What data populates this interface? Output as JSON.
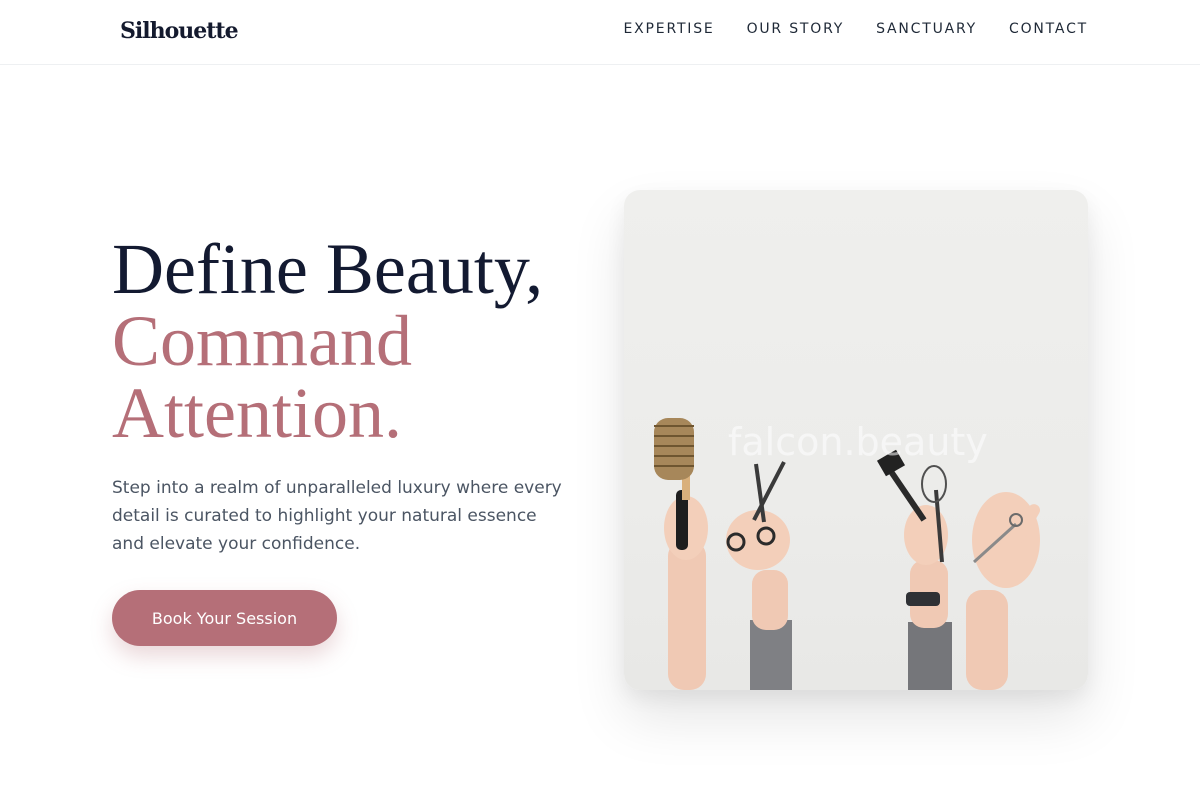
{
  "brand": {
    "logo_text": "Silhouette"
  },
  "nav": {
    "items": [
      {
        "label": "EXPERTISE"
      },
      {
        "label": "OUR STORY"
      },
      {
        "label": "SANCTUARY"
      },
      {
        "label": "CONTACT"
      }
    ]
  },
  "hero": {
    "heading_lines": [
      "Define Beauty,",
      "Command",
      "Attention."
    ],
    "description": "Step into a realm of unparalleled luxury where every detail is curated to highlight your natural essence and elevate your confidence.",
    "cta_label": "Book Your Session",
    "image_watermark": "falcon.beauty"
  },
  "colors": {
    "accent": "#b56f78",
    "heading_dark": "#131a31",
    "body_text": "#4b5563",
    "background": "#ffffff"
  }
}
